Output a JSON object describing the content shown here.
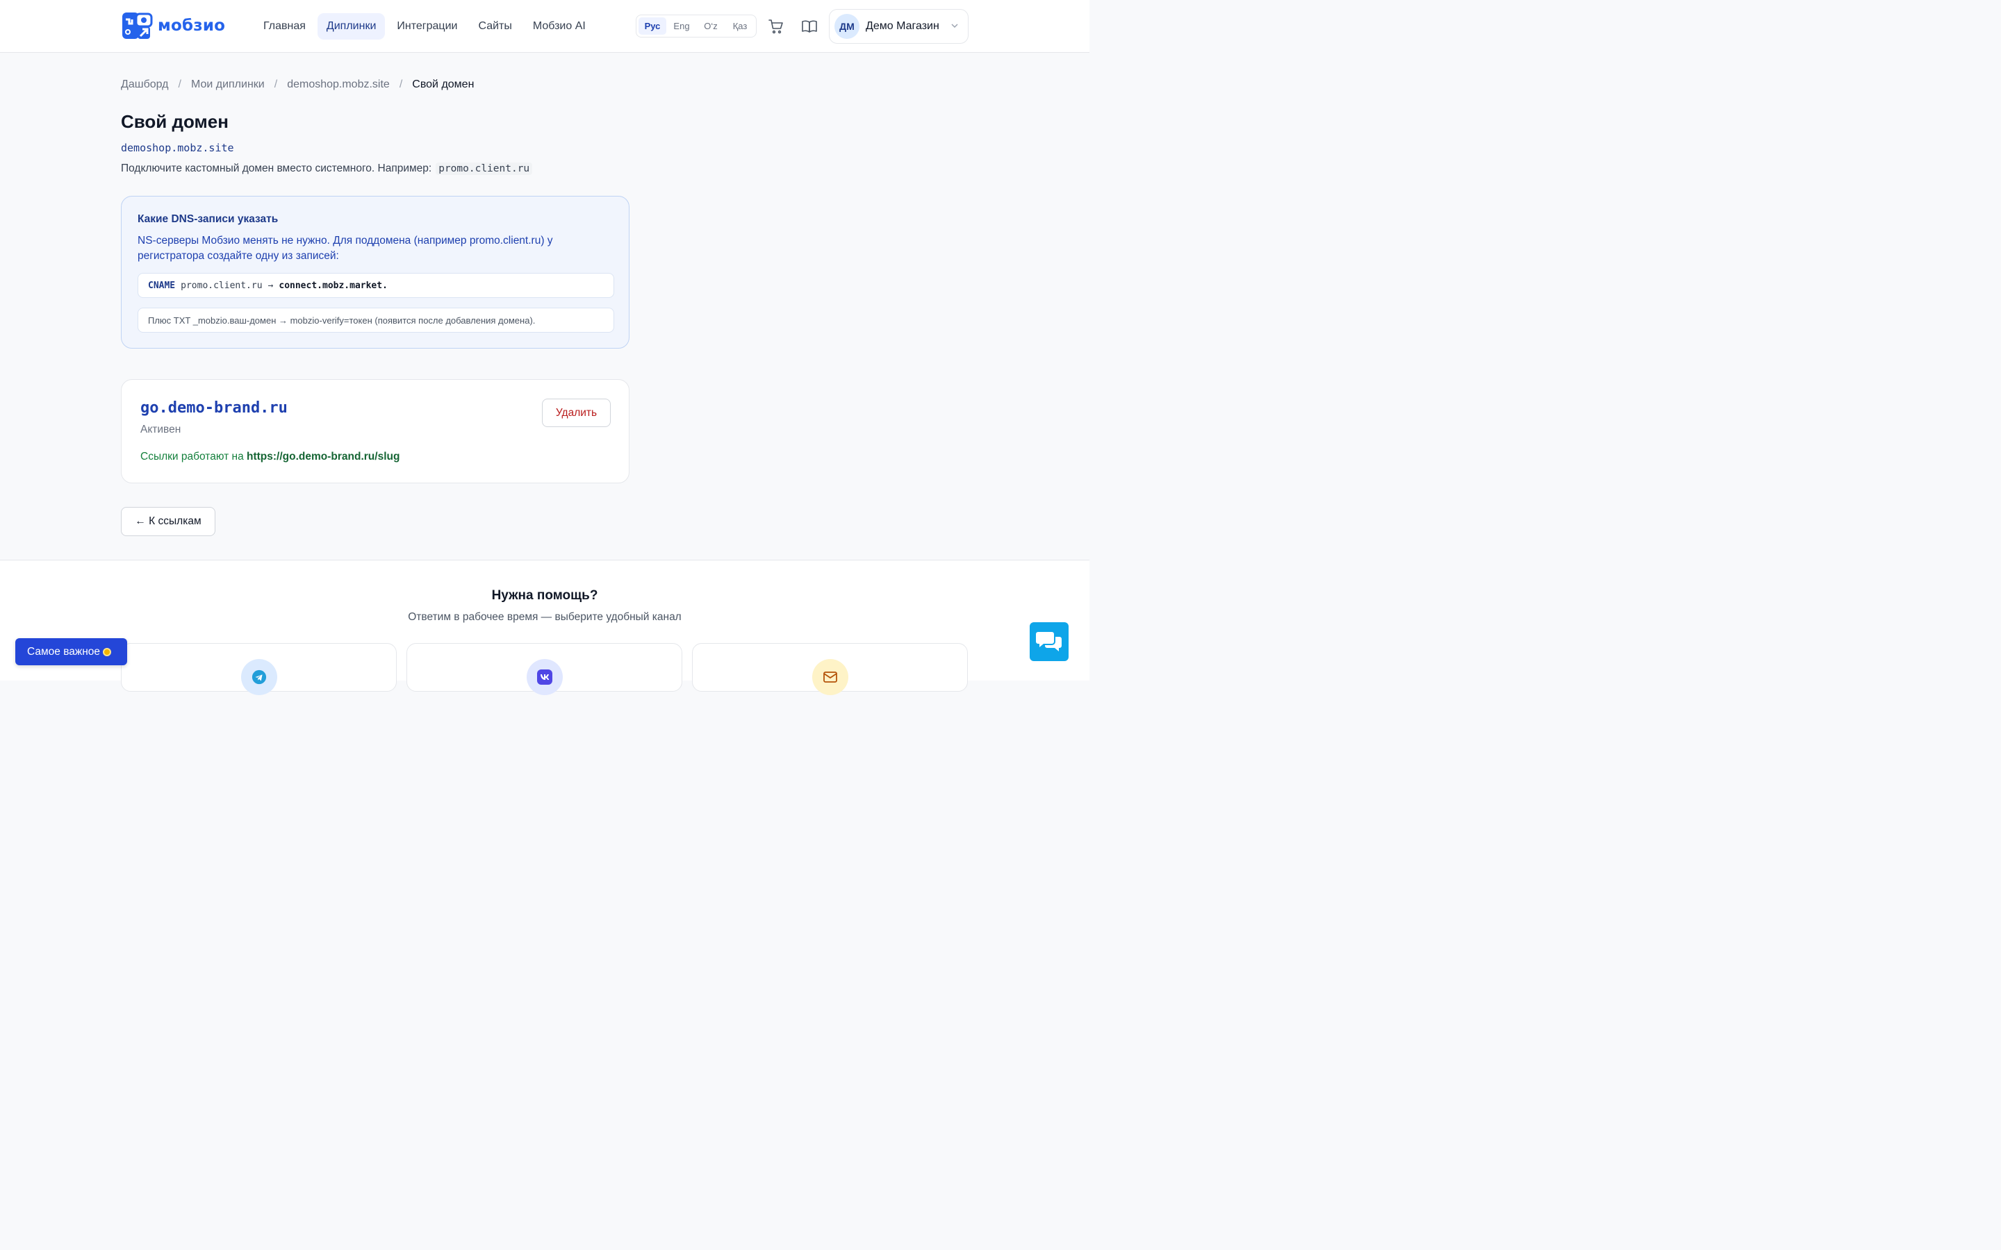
{
  "header": {
    "logo_text": "мобзио",
    "nav": [
      {
        "label": "Главная",
        "active": false
      },
      {
        "label": "Диплинки",
        "active": true
      },
      {
        "label": "Интеграции",
        "active": false
      },
      {
        "label": "Сайты",
        "active": false
      },
      {
        "label": "Мобзио AI",
        "active": false
      }
    ],
    "languages": [
      {
        "label": "Рус",
        "active": true
      },
      {
        "label": "Eng",
        "active": false
      },
      {
        "label": "O‘z",
        "active": false
      },
      {
        "label": "Қаз",
        "active": false
      }
    ],
    "user": {
      "initials": "ДМ",
      "name": "Демо Магазин"
    }
  },
  "breadcrumb": [
    "Дашборд",
    "Мои диплинки",
    "demoshop.mobz.site",
    "Свой домен"
  ],
  "page": {
    "title": "Свой домен",
    "domain": "demoshop.mobz.site",
    "description": "Подключите кастомный домен вместо системного. Например:",
    "example": "promo.client.ru"
  },
  "dns": {
    "title": "Какие DNS-записи указать",
    "text": "NS-серверы Мобзио менять не нужно. Для поддомена (например promo.client.ru) у регистратора создайте одну из записей:",
    "record": {
      "type": "CNAME",
      "host": "promo.client.ru",
      "arrow": "→",
      "target": "connect.mobz.market."
    },
    "txt_note": "Плюс TXT _mobzio.ваш-домен → mobzio-verify=токен (появится после добавления домена)."
  },
  "custom_domain": {
    "name": "go.demo-brand.ru",
    "status": "Активен",
    "links_prefix": "Ссылки работают на",
    "links_url": "https://go.demo-brand.ru/slug",
    "delete_label": "Удалить"
  },
  "back_label": "← К ссылкам",
  "help": {
    "title": "Нужна помощь?",
    "subtitle": "Ответим в рабочее время — выберите удобный канал",
    "channels": [
      {
        "icon": "telegram-icon",
        "color": "#dbeafe"
      },
      {
        "icon": "vk-icon",
        "color": "#e0e7ff"
      },
      {
        "icon": "mail-icon",
        "color": "#fef3c7"
      }
    ]
  },
  "important_label": "Самое важное",
  "colors": {
    "accent": "#2563eb",
    "success": "#15803d",
    "danger": "#b91c1c"
  }
}
